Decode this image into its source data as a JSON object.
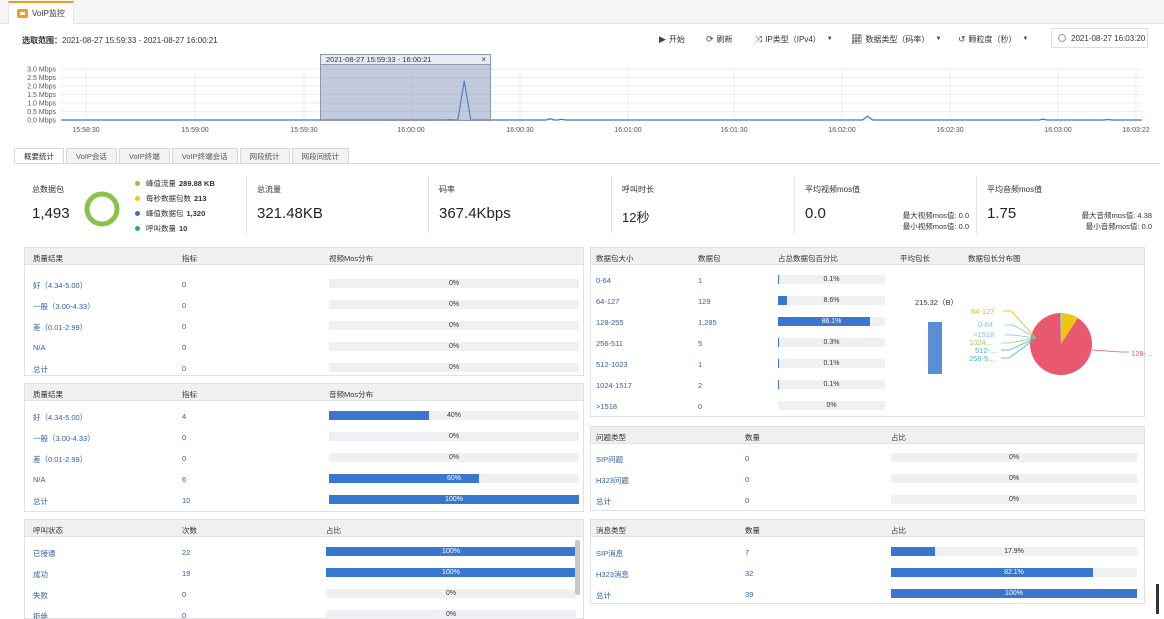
{
  "app_tab": {
    "label": "VoIP监控"
  },
  "toolbar": {
    "range_label": "选取范围：",
    "range_value": "2021-08-27 15:59:33 - 2021-08-27 16:00:21",
    "start": "开始",
    "refresh": "刷新",
    "ip_type": "IP类型（IPv4）",
    "data_type": "数据类型（码率）",
    "granularity": "颗粒度（秒）",
    "date": "2021-08-27 16:03:20"
  },
  "chart_data": {
    "type": "line",
    "y_ticks": [
      "3.0 Mbps",
      "2.5 Mbps",
      "2.0 Mbps",
      "1.5 Mbps",
      "1.0 Mbps",
      "0.5 Mbps",
      "0.0 Mbps"
    ],
    "x_ticks": [
      "15:58:30",
      "15:59:00",
      "15:59:30",
      "16:00:00",
      "16:00:30",
      "16:01:00",
      "16:01:30",
      "16:02:00",
      "16:02:30",
      "16:03:00",
      "16:03:22"
    ],
    "ylim": [
      0,
      3.0
    ],
    "points": [
      [
        0,
        0
      ],
      [
        296,
        0
      ],
      [
        299,
        0.03
      ],
      [
        302,
        0
      ],
      [
        305,
        0
      ],
      [
        310,
        2.3
      ],
      [
        315,
        0
      ],
      [
        373,
        0
      ],
      [
        376,
        0.08
      ],
      [
        379,
        0
      ],
      [
        382,
        0
      ],
      [
        385,
        0.04
      ],
      [
        388,
        0
      ],
      [
        616,
        0
      ],
      [
        620,
        0.22
      ],
      [
        624,
        0
      ],
      [
        752,
        0
      ],
      [
        755,
        0.05
      ],
      [
        758,
        0
      ],
      [
        802,
        0
      ],
      [
        805,
        0.03
      ],
      [
        808,
        0
      ],
      [
        831,
        0
      ]
    ],
    "x_span": 831,
    "selection_label": "2021-08-27 15:59:33 - 16:00:21",
    "selection_close": "×"
  },
  "stat_tabs": [
    "概要统计",
    "VoIP会话",
    "VoIP终端",
    "VoIP终端会话",
    "网段统计",
    "网段间统计"
  ],
  "summary": {
    "total_packets_label": "总数据包",
    "total_packets": "1,493",
    "legend": [
      {
        "label": "峰值流量",
        "value": "289.88 KB",
        "color": "#8bc34a"
      },
      {
        "label": "每秒数据包数",
        "value": "213",
        "color": "#f1c40f"
      },
      {
        "label": "峰值数据包",
        "value": "1,320",
        "color": "#3a6ec0"
      },
      {
        "label": "呼叫数量",
        "value": "10",
        "color": "#26a69a"
      }
    ],
    "total_flow_label": "总流量",
    "total_flow": "321.48KB",
    "bitrate_label": "码率",
    "bitrate": "367.4Kbps",
    "call_duration_label": "呼叫时长",
    "call_duration": "12秒",
    "avg_video_mos_label": "平均视频mos值",
    "avg_video_mos": "0.0",
    "max_video_mos": "最大视频mos值: 0.0",
    "min_video_mos": "最小视频mos值: 0.0",
    "avg_audio_mos_label": "平均音频mos值",
    "avg_audio_mos": "1.75",
    "max_audio_mos": "最大音频mos值: 4.38",
    "min_audio_mos": "最小音频mos值: 0.0"
  },
  "video_mos": {
    "headers": [
      "质量结果",
      "指标",
      "视频Mos分布"
    ],
    "rows": [
      {
        "q": "好（4.34-5.00）",
        "v": "0",
        "pct": "0%",
        "f": 0
      },
      {
        "q": "一般（3.00-4.33）",
        "v": "0",
        "pct": "0%",
        "f": 0
      },
      {
        "q": "差（0.01-2.99）",
        "v": "0",
        "pct": "0%",
        "f": 0
      },
      {
        "q": "N/A",
        "v": "0",
        "pct": "0%",
        "f": 0
      },
      {
        "q": "总计",
        "v": "0",
        "pct": "0%",
        "f": 0
      }
    ]
  },
  "audio_mos": {
    "headers": [
      "质量结果",
      "指标",
      "音频Mos分布"
    ],
    "rows": [
      {
        "q": "好（4.34-5.00）",
        "v": "4",
        "pct": "40%",
        "f": 0.4
      },
      {
        "q": "一般（3.00-4.33）",
        "v": "0",
        "pct": "0%",
        "f": 0
      },
      {
        "q": "差（0.01-2.99）",
        "v": "0",
        "pct": "0%",
        "f": 0
      },
      {
        "q": "N/A",
        "v": "6",
        "pct": "60%",
        "f": 0.6
      },
      {
        "q": "总计",
        "v": "10",
        "pct": "100%",
        "f": 1
      }
    ]
  },
  "call_status": {
    "headers": [
      "呼叫状态",
      "次数",
      "占比"
    ],
    "rows": [
      {
        "q": "已接通",
        "v": "22",
        "pct": "100%",
        "f": 1
      },
      {
        "q": "成功",
        "v": "19",
        "pct": "100%",
        "f": 1
      },
      {
        "q": "失败",
        "v": "0",
        "pct": "0%",
        "f": 0
      },
      {
        "q": "拒绝",
        "v": "0",
        "pct": "0%",
        "f": 0
      }
    ]
  },
  "packet_size": {
    "headers": [
      "数据包大小",
      "数据包",
      "占总数据包百分比",
      "平均包长",
      "数据包长分布图"
    ],
    "rows": [
      {
        "q": "0-64",
        "v": "1",
        "pct": "0.1%",
        "f": 0.001
      },
      {
        "q": "64-127",
        "v": "129",
        "pct": "8.6%",
        "f": 0.086
      },
      {
        "q": "128-255",
        "v": "1,285",
        "pct": "86.1%",
        "f": 0.861
      },
      {
        "q": "256-511",
        "v": "5",
        "pct": "0.3%",
        "f": 0.003
      },
      {
        "q": "512-1023",
        "v": "1",
        "pct": "0.1%",
        "f": 0.001
      },
      {
        "q": "1024-1517",
        "v": "2",
        "pct": "0.1%",
        "f": 0.001
      },
      {
        "q": ">1518",
        "v": "0",
        "pct": "0%",
        "f": 0
      }
    ],
    "avg_len": "215.32（B）",
    "pie_labels": [
      "64-127",
      "0-64",
      ">1518",
      "1024...",
      "512-...",
      "256-5...",
      "128-..."
    ]
  },
  "problem_type": {
    "headers": [
      "问题类型",
      "数量",
      "占比"
    ],
    "rows": [
      {
        "q": "SIP问题",
        "v": "0",
        "pct": "0%",
        "f": 0
      },
      {
        "q": "H323问题",
        "v": "0",
        "pct": "0%",
        "f": 0
      },
      {
        "q": "总计",
        "v": "0",
        "pct": "0%",
        "f": 0
      }
    ]
  },
  "message_type": {
    "headers": [
      "消息类型",
      "数量",
      "占比"
    ],
    "rows": [
      {
        "q": "SIP消息",
        "v": "7",
        "pct": "17.9%",
        "f": 0.179
      },
      {
        "q": "H323消息",
        "v": "32",
        "pct": "82.1%",
        "f": 0.821
      },
      {
        "q": "总计",
        "v": "39",
        "pct": "100%",
        "f": 1
      }
    ]
  }
}
